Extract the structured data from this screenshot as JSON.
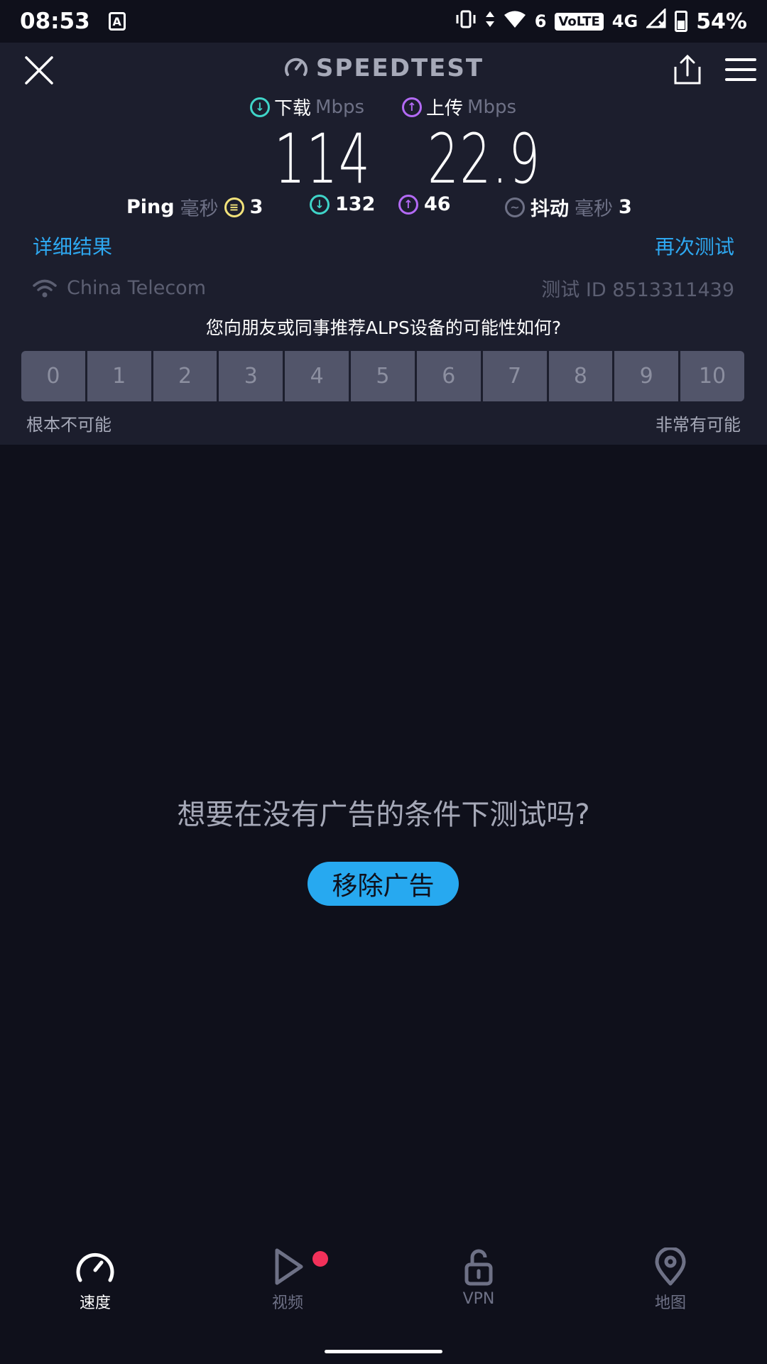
{
  "status_bar": {
    "time": "08:53",
    "notification_icon_letter": "A",
    "signal_small": "6",
    "volte": "VoLTE",
    "network": "4G",
    "battery": "54%"
  },
  "header": {
    "brand": "SPEEDTEST",
    "icons": [
      "close-icon",
      "speedometer-icon",
      "share-icon",
      "menu-icon"
    ]
  },
  "results": {
    "download_label": "下载",
    "upload_label": "上传",
    "unit": "Mbps",
    "download_value": "114",
    "upload_value": "22.9"
  },
  "stats": {
    "ping_label": "Ping",
    "ms_unit": "毫秒",
    "ping_value": "3",
    "download_ping": "132",
    "upload_ping": "46",
    "jitter_label": "抖动",
    "jitter_value": "3"
  },
  "links": {
    "details": "详细结果",
    "retest": "再次测试"
  },
  "connection": {
    "isp": "China Telecom",
    "test_id": "测试 ID 8513311439"
  },
  "survey": {
    "question": "您向朋友或同事推荐ALPS设备的可能性如何?",
    "scale": [
      "0",
      "1",
      "2",
      "3",
      "4",
      "5",
      "6",
      "7",
      "8",
      "9",
      "10"
    ],
    "low_label": "根本不可能",
    "high_label": "非常有可能"
  },
  "ad": {
    "question": "想要在没有广告的条件下测试吗?",
    "button": "移除广告"
  },
  "nav": {
    "speed": "速度",
    "video": "视频",
    "vpn": "VPN",
    "map": "地图"
  },
  "colors": {
    "background": "#0f101b",
    "panel": "#1c1e2d",
    "accent_blue": "#27a9f0",
    "download_teal": "#3fd4c8",
    "upload_purple": "#b36af5",
    "ping_yellow": "#f2e27a",
    "badge_red": "#f2315a"
  }
}
